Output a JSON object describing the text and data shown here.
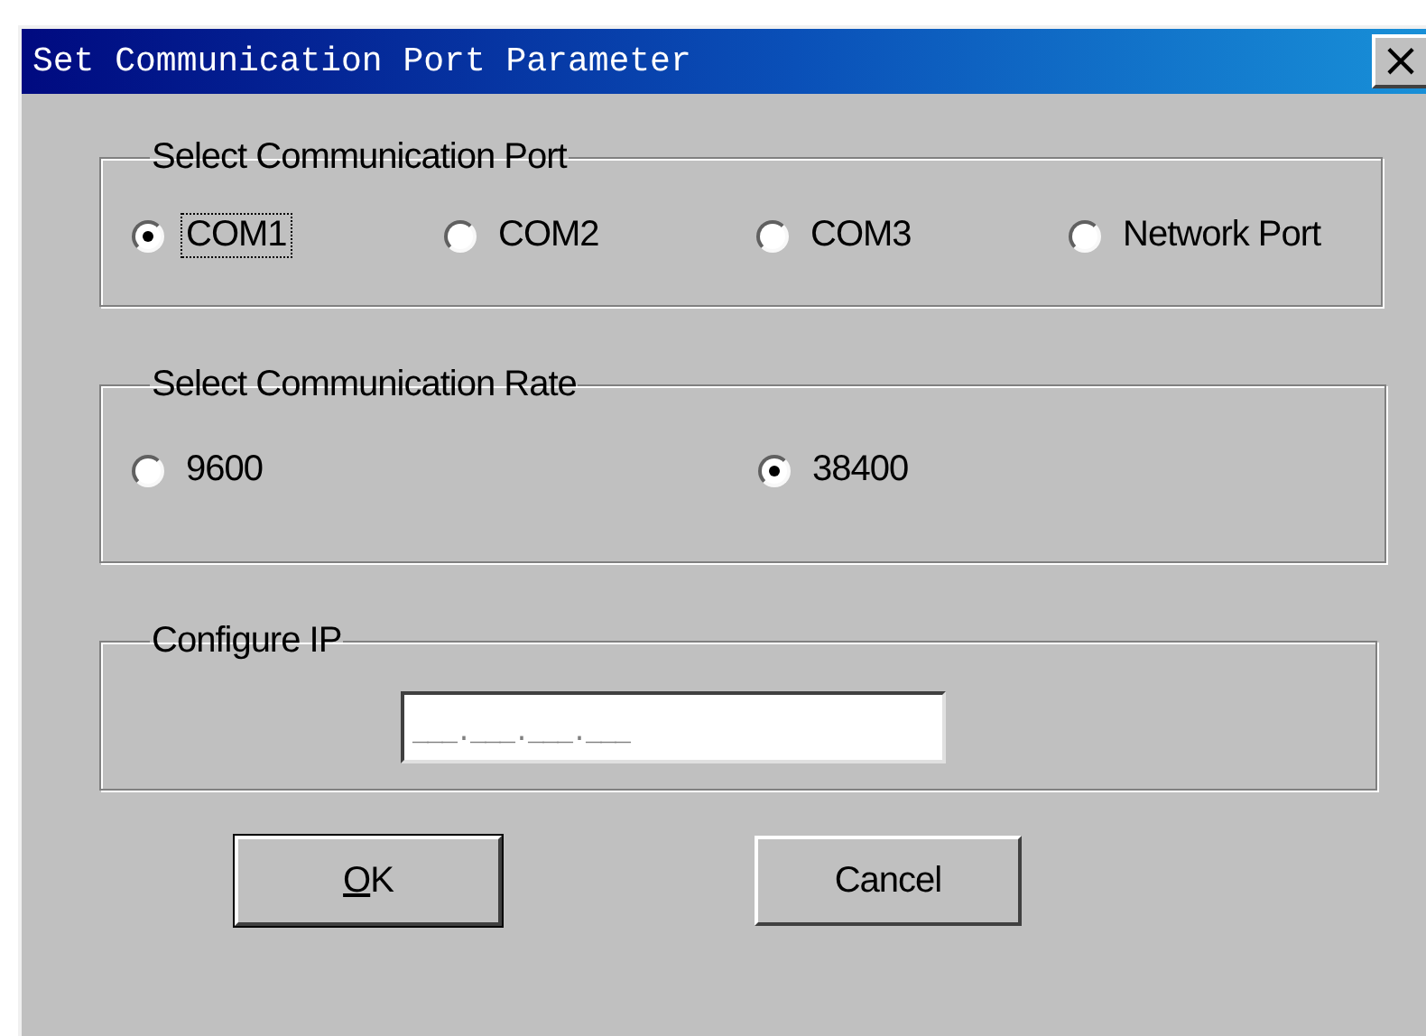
{
  "window": {
    "title": "Set Communication Port Parameter",
    "close_label": "×"
  },
  "groups": [
    {
      "kind": "radios",
      "title": "Select Communication Port",
      "options": [
        {
          "label": "COM1",
          "selected": true,
          "focused": true
        },
        {
          "label": "COM2",
          "selected": false,
          "focused": false
        },
        {
          "label": "COM3",
          "selected": false,
          "focused": false
        },
        {
          "label": "Network Port",
          "selected": false,
          "focused": false
        }
      ]
    },
    {
      "kind": "radios",
      "title": "Select Communication Rate",
      "options": [
        {
          "label": "9600",
          "selected": false,
          "focused": false
        },
        {
          "label": "38400",
          "selected": true,
          "focused": false
        }
      ]
    },
    {
      "kind": "ip",
      "title": "Configure IP",
      "value": "___.___.___.___"
    }
  ],
  "buttons": [
    {
      "label_parts": [
        {
          "text": "O",
          "underlined": true
        },
        {
          "text": "K",
          "underlined": false
        }
      ],
      "default": true
    },
    {
      "label": "Cancel",
      "default": false
    }
  ]
}
